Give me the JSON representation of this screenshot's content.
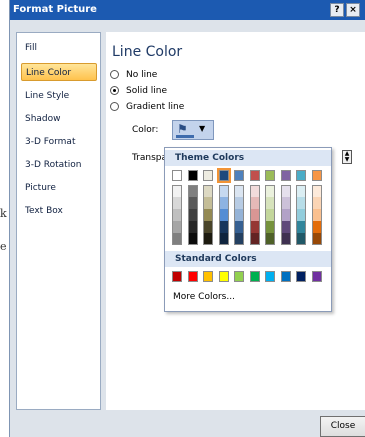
{
  "window": {
    "title": "Format Picture",
    "help_label": "?",
    "close_label": "×"
  },
  "background_text": [
    "k",
    "e"
  ],
  "sidebar": {
    "items": [
      {
        "label": "Fill"
      },
      {
        "label": "Line Color"
      },
      {
        "label": "Line Style"
      },
      {
        "label": "Shadow"
      },
      {
        "label": "3-D Format"
      },
      {
        "label": "3-D Rotation"
      },
      {
        "label": "Picture"
      },
      {
        "label": "Text Box"
      }
    ],
    "selected": "Line Color"
  },
  "content": {
    "heading": "Line Color",
    "options": [
      {
        "label": "No line",
        "checked": false
      },
      {
        "label": "Solid line",
        "checked": true
      },
      {
        "label": "Gradient line",
        "checked": false
      }
    ],
    "color_label": "Color:",
    "transparency_label": "Transpa"
  },
  "color_picker": {
    "theme_header": "Theme Colors",
    "standard_header": "Standard Colors",
    "more_label": "More Colors...",
    "selected_theme_color": "#1f497d",
    "theme_rows": [
      [
        "#ffffff",
        "#000000",
        "#eeece1",
        "#1f497d",
        "#4f81bd",
        "#c0504d",
        "#9bbb59",
        "#8064a2",
        "#4bacc6",
        "#f79646"
      ],
      [
        "#f2f2f2",
        "#7f7f7f",
        "#ddd9c3",
        "#c6d9f0",
        "#dbe5f1",
        "#f2dcdb",
        "#ebf1dd",
        "#e5e0ec",
        "#dbeef3",
        "#fdeada"
      ],
      [
        "#d8d8d8",
        "#595959",
        "#c4bd97",
        "#8db3e2",
        "#b8cce4",
        "#e5b9b7",
        "#d7e3bc",
        "#ccc1d9",
        "#b7dde8",
        "#fbd5b5"
      ],
      [
        "#bfbfbf",
        "#3f3f3f",
        "#938953",
        "#548dd4",
        "#95b3d7",
        "#d99694",
        "#c3d69b",
        "#b2a2c7",
        "#92cddc",
        "#fac08f"
      ],
      [
        "#a5a5a5",
        "#262626",
        "#494429",
        "#17365d",
        "#366092",
        "#953734",
        "#76923c",
        "#5f497a",
        "#31859b",
        "#e36c09"
      ],
      [
        "#7f7f7f",
        "#0c0c0c",
        "#1d1b10",
        "#0f243e",
        "#244061",
        "#632423",
        "#4f6128",
        "#3f3151",
        "#205867",
        "#974806"
      ]
    ],
    "standard_colors": [
      "#c00000",
      "#ff0000",
      "#ffc000",
      "#ffff00",
      "#92d050",
      "#00b050",
      "#00b0f0",
      "#0070c0",
      "#002060",
      "#7030a0"
    ]
  },
  "footer": {
    "close_label": "Close"
  }
}
